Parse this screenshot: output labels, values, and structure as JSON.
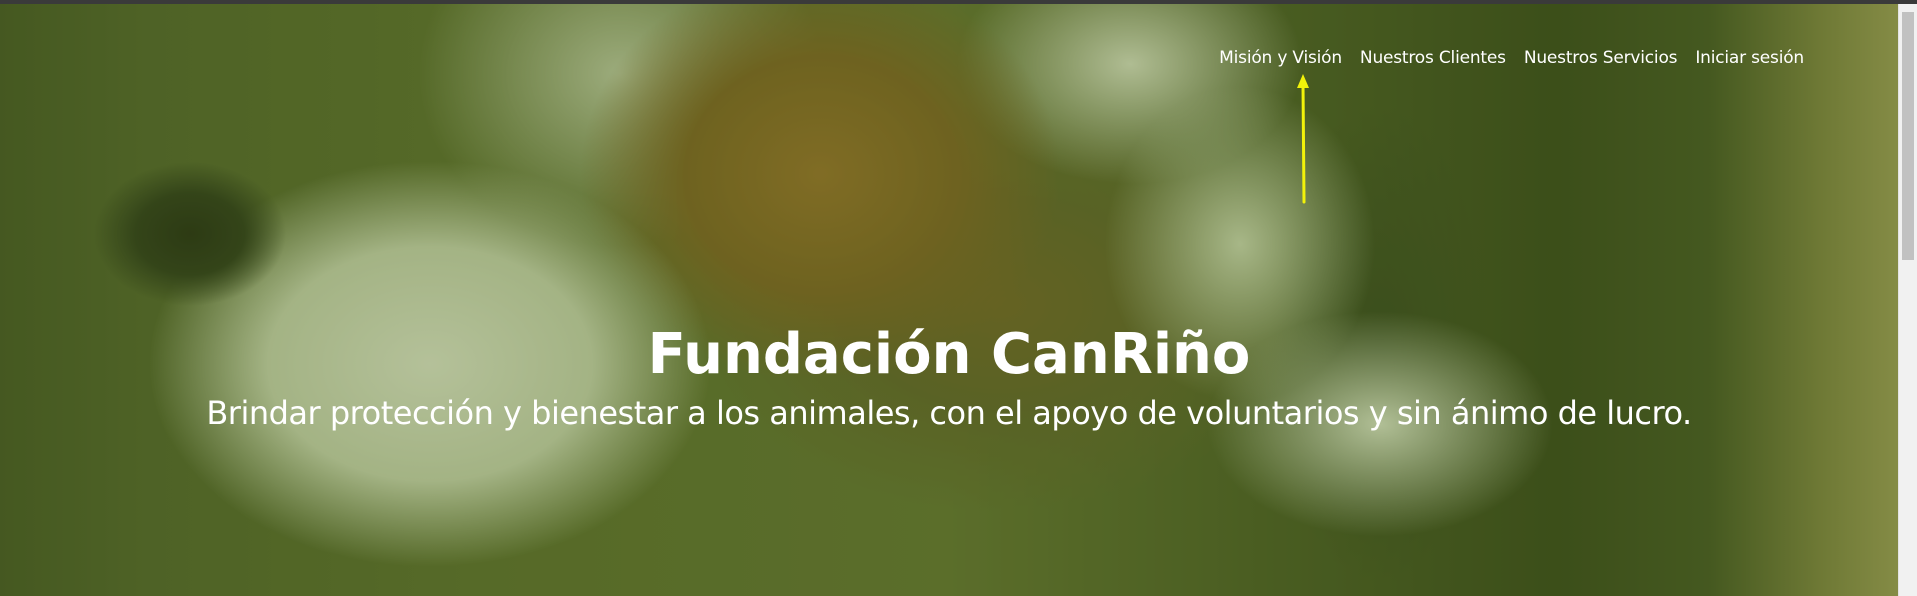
{
  "nav": {
    "items": [
      {
        "label": "Misión y Visión"
      },
      {
        "label": "Nuestros Clientes"
      },
      {
        "label": "Nuestros Servicios"
      },
      {
        "label": "Iniciar sesión"
      }
    ]
  },
  "hero": {
    "title": "Fundación CanRiño",
    "subtitle": "Brindar protección y bienestar a los animales, con el apoyo de voluntarios y sin ánimo de lucro."
  },
  "annotation": {
    "icon": "arrow-up-icon",
    "color": "#f2f20a"
  },
  "colors": {
    "overlay": "#58701e",
    "text": "#ffffff"
  }
}
